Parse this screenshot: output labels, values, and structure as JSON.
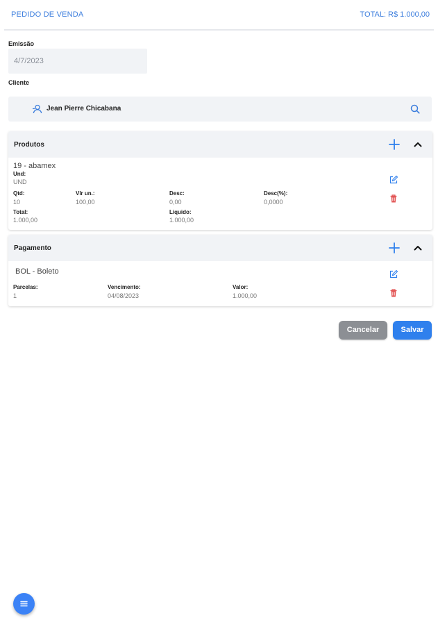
{
  "header": {
    "title": "PEDIDO DE VENDA",
    "total": "TOTAL: R$ 1.000,00"
  },
  "emissao": {
    "label": "Emissão",
    "value": "4/7/2023"
  },
  "cliente": {
    "label": "Cliente",
    "name": "Jean Pierre Chicabana",
    "icons": {
      "person": "person-icon",
      "search": "search-icon"
    }
  },
  "produtos": {
    "header": "Produtos",
    "item": {
      "title": "19 - abamex",
      "und_label": "Und:",
      "und_value": "UND",
      "qtd_label": "Qtd:",
      "qtd_value": "10",
      "vlr_label": "Vlr un.:",
      "vlr_value": "100,00",
      "desc_label": "Desc:",
      "desc_value": "0,00",
      "descp_label": "Desc(%):",
      "descp_value": "0,0000",
      "total_label": "Total:",
      "total_value": "1.000,00",
      "liquido_label": "Liquido:",
      "liquido_value": "1.000,00"
    }
  },
  "pagamento": {
    "header": "Pagamento",
    "item": {
      "title": "BOL - Boleto",
      "parcelas_label": "Parcelas:",
      "parcelas_value": "1",
      "vencimento_label": "Vencimento:",
      "vencimento_value": "04/08/2023",
      "valor_label": "Valor:",
      "valor_value": "1.000,00"
    }
  },
  "actions": {
    "cancel": "Cancelar",
    "save": "Salvar"
  },
  "colors": {
    "accent": "#2f80ed",
    "delete": "#e25555",
    "cancel": "#8c8f94"
  }
}
